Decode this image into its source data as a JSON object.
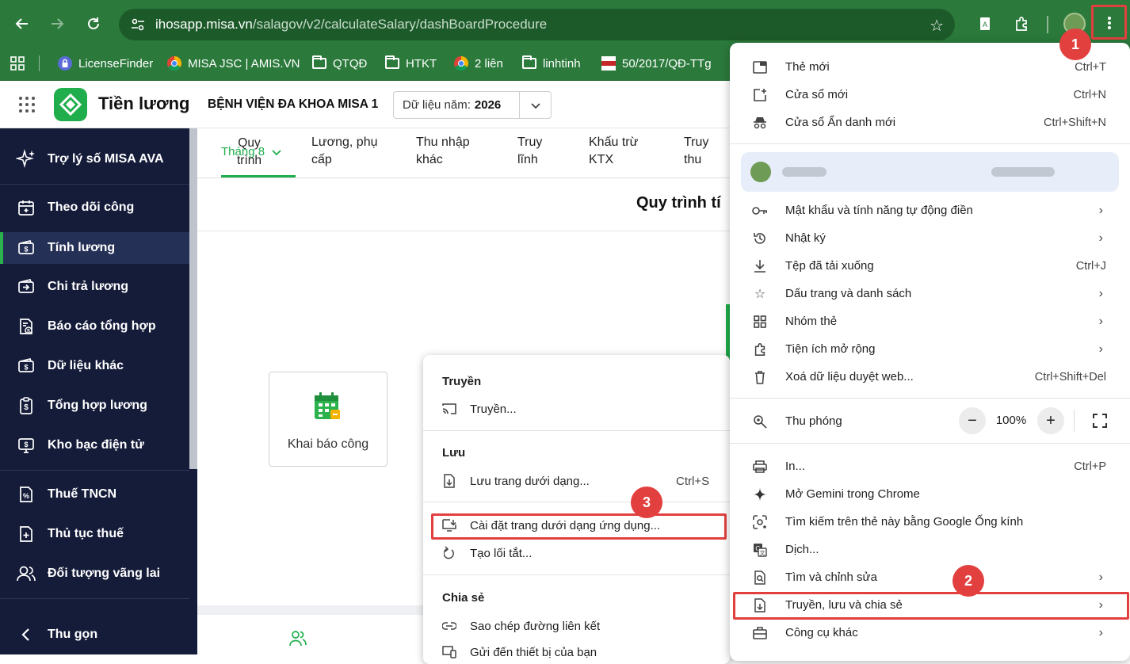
{
  "browser": {
    "url_host": "ihosapp.misa.vn",
    "url_path": "/salagov/v2/calculateSalary/dashBoardProcedure",
    "bookmarks": [
      {
        "label": "LicenseFinder"
      },
      {
        "label": "MISA JSC | AMIS.VN"
      },
      {
        "label": "QTQĐ"
      },
      {
        "label": "HTKT"
      },
      {
        "label": "2 liên"
      },
      {
        "label": "linhtinh"
      },
      {
        "label": "50/2017/QĐ-TTg"
      }
    ]
  },
  "app": {
    "title": "Tiền lương",
    "org": "BỆNH VIỆN ĐA KHOA MISA 1",
    "year_label": "Dữ liệu năm:",
    "year_value": "2026"
  },
  "sidebar": {
    "assistant": "Trợ lý số MISA AVA",
    "items": [
      {
        "label": "Theo dõi công"
      },
      {
        "label": "Tính lương"
      },
      {
        "label": "Chi trả lương"
      },
      {
        "label": "Báo cáo tổng hợp"
      },
      {
        "label": "Dữ liệu khác"
      },
      {
        "label": "Tổng hợp lương"
      },
      {
        "label": "Kho bạc điện tử"
      },
      {
        "label": "Thuế TNCN"
      },
      {
        "label": "Thủ tục thuế"
      },
      {
        "label": "Đối tượng vãng lai"
      }
    ],
    "collapse": "Thu gọn"
  },
  "tabs": {
    "month": "Tháng 8",
    "items": [
      {
        "line1": "Quy",
        "line2": "trình"
      },
      {
        "line1": "Lương, phụ",
        "line2": "cấp"
      },
      {
        "line1": "Thu nhập",
        "line2": "khác"
      },
      {
        "line1": "Truy",
        "line2": "lĩnh"
      },
      {
        "line1": "Khấu trừ",
        "line2": "KTX"
      },
      {
        "line1": "Truy",
        "line2": "thu"
      }
    ]
  },
  "main": {
    "heading": "Quy trình tí",
    "card_label": "Khai báo công"
  },
  "submenu": {
    "cast_head": "Truyền",
    "cast_item": "Truyền...",
    "save_head": "Lưu",
    "save_item": "Lưu trang dưới dạng...",
    "save_shortcut": "Ctrl+S",
    "install_item": "Cài đặt trang dưới dạng ứng dụng...",
    "shortcut_item": "Tạo lối tắt...",
    "share_head": "Chia sẻ",
    "copy_link": "Sao chép đường liên kết",
    "send_device": "Gửi đến thiết bị của bạn"
  },
  "chrome_menu": {
    "new_tab": "Thẻ mới",
    "new_tab_sc": "Ctrl+T",
    "new_window": "Cửa sổ mới",
    "new_window_sc": "Ctrl+N",
    "incognito": "Cửa sổ Ẩn danh mới",
    "incognito_sc": "Ctrl+Shift+N",
    "passwords": "Mật khẩu và tính năng tự động điền",
    "history": "Nhật ký",
    "downloads": "Tệp đã tải xuống",
    "downloads_sc": "Ctrl+J",
    "bookmarks": "Dấu trang và danh sách",
    "tab_groups": "Nhóm thẻ",
    "extensions": "Tiện ích mở rộng",
    "clear_data": "Xoá dữ liệu duyệt web...",
    "clear_data_sc": "Ctrl+Shift+Del",
    "zoom": "Thu phóng",
    "zoom_value": "100%",
    "zoom_minus": "−",
    "zoom_plus": "+",
    "print": "In...",
    "print_sc": "Ctrl+P",
    "gemini": "Mở Gemini trong Chrome",
    "lens": "Tìm kiếm trên thẻ này bằng Google Ống kính",
    "translate": "Dịch...",
    "find_edit": "Tìm và chỉnh sửa",
    "cast_save_share": "Truyền, lưu và chia sẻ",
    "more_tools": "Công cụ khác"
  },
  "annotations": {
    "badge1": "1",
    "badge2": "2",
    "badge3": "3"
  },
  "colors": {
    "brand_green": "#2b7a3c",
    "sidebar_bg": "#151c3a",
    "highlight_red": "#e2403f",
    "active_green": "#2bb24c"
  }
}
